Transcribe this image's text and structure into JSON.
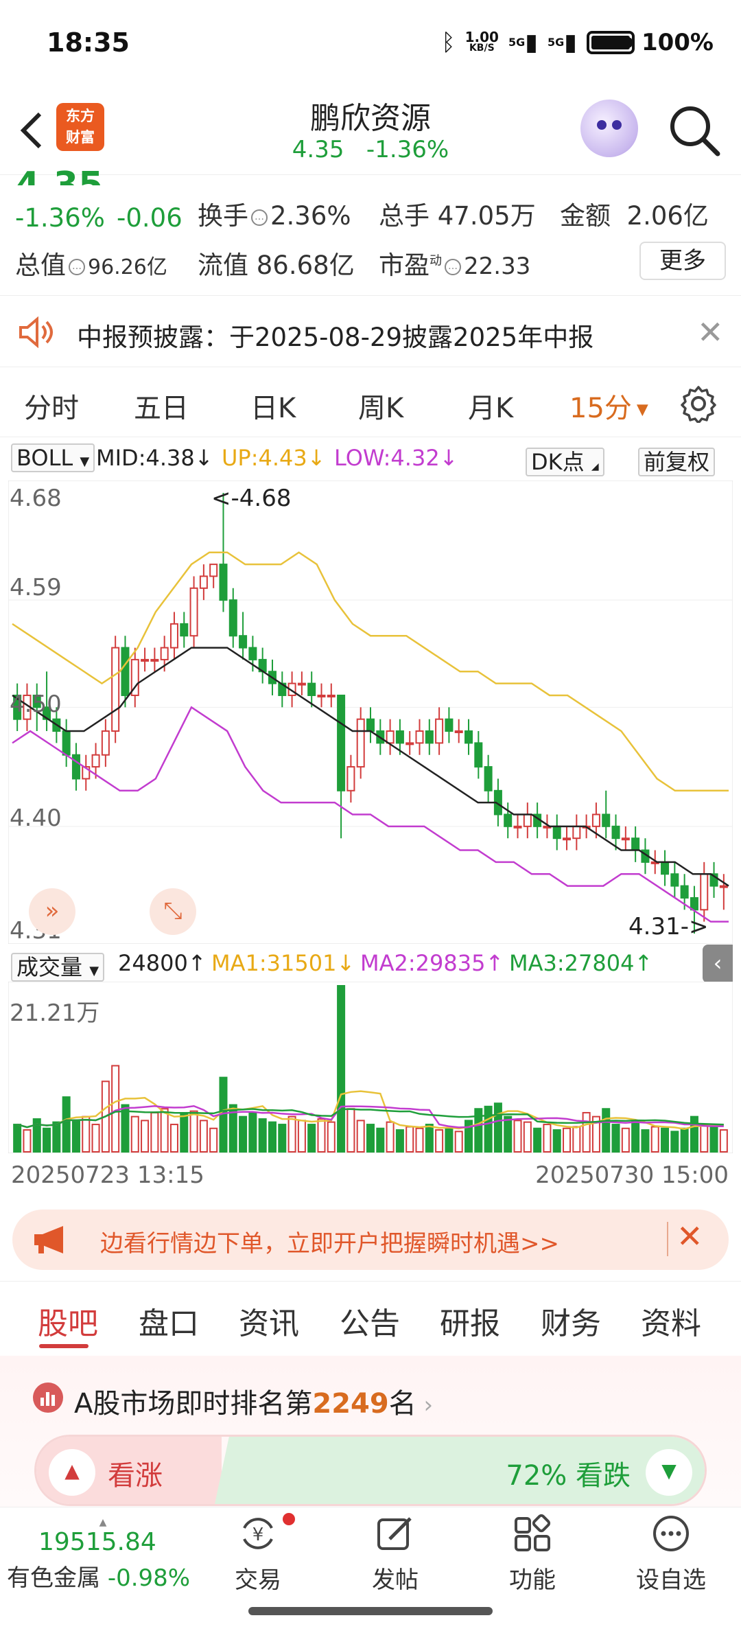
{
  "status_bar": {
    "time": "18:35",
    "speed_value": "1.00",
    "speed_unit": "KB/S",
    "net1": "5G",
    "net2": "5G",
    "battery": "100%"
  },
  "header": {
    "logo_line1": "东方",
    "logo_line2": "财富",
    "title": "鹏欣资源",
    "price": "4.35",
    "change": "-1.36%"
  },
  "quote": {
    "change_pct": "-1.36%",
    "change_amt": "-0.06",
    "turnover_label": "换手",
    "turnover": "2.36%",
    "volume_label": "总手",
    "volume": "47.05万",
    "amount_label": "金额",
    "amount": "2.06亿",
    "mcap_label": "总值",
    "mcap": "96.26亿",
    "float_label": "流值",
    "float_cap": "86.68亿",
    "pe_label": "市盈",
    "pe_sup": "动",
    "pe": "22.33",
    "more": "更多"
  },
  "notice": {
    "text": "中报预披露：于2025-08-29披露2025年中报"
  },
  "period_tabs": [
    "分时",
    "五日",
    "日K",
    "周K",
    "月K",
    "15分"
  ],
  "indicator": {
    "name": "BOLL",
    "mid": "MID:4.38↓",
    "up": "UP:4.43↓",
    "low": "LOW:4.32↓",
    "dk": "DK点",
    "adjust": "前复权"
  },
  "kchart": {
    "y_labels": [
      "4.68",
      "4.59",
      "4.50",
      "4.40",
      "4.31"
    ],
    "high_label": "<-4.68",
    "low_label": "4.31->"
  },
  "volume": {
    "name": "成交量",
    "current": "24800↑",
    "ma1": "MA1:31501↓",
    "ma2": "MA2:29835↑",
    "ma3": "MA3:27804↑",
    "max_label": "21.21万",
    "start": "20250723 13:15",
    "end": "20250730 15:00"
  },
  "ad": {
    "text": "边看行情边下单，立即开户把握瞬时机遇>>"
  },
  "tabs": [
    "股吧",
    "盘口",
    "资讯",
    "公告",
    "研报",
    "财务",
    "资料"
  ],
  "rank": {
    "prefix": "A股市场即时排名第",
    "value": "2249",
    "suffix": "名"
  },
  "vote": {
    "up": "看涨",
    "down": "72% 看跌"
  },
  "bottom_nav": {
    "index_value": "19515.84",
    "index_name": "有色金属",
    "index_change": "-0.98%",
    "items": [
      "交易",
      "发帖",
      "功能",
      "设自选"
    ]
  },
  "colors": {
    "up": "#d23c3c",
    "down": "#1e9e3a",
    "accent": "#d86b1f",
    "boll_up": "#e8c23a",
    "boll_low": "#c23ccf",
    "boll_mid": "#222222"
  },
  "chart_data": {
    "type": "candlestick",
    "ylim": [
      4.31,
      4.68
    ],
    "candles_ohlc": [
      [
        4.51,
        4.52,
        4.48,
        4.49
      ],
      [
        4.49,
        4.52,
        4.48,
        4.51
      ],
      [
        4.51,
        4.52,
        4.48,
        4.5
      ],
      [
        4.5,
        4.53,
        4.48,
        4.49
      ],
      [
        4.49,
        4.5,
        4.47,
        4.48
      ],
      [
        4.48,
        4.49,
        4.45,
        4.46
      ],
      [
        4.46,
        4.47,
        4.43,
        4.44
      ],
      [
        4.44,
        4.46,
        4.43,
        4.45
      ],
      [
        4.45,
        4.47,
        4.44,
        4.46
      ],
      [
        4.46,
        4.49,
        4.45,
        4.48
      ],
      [
        4.48,
        4.56,
        4.47,
        4.55
      ],
      [
        4.55,
        4.56,
        4.5,
        4.51
      ],
      [
        4.51,
        4.55,
        4.5,
        4.54
      ],
      [
        4.54,
        4.55,
        4.53,
        4.54
      ],
      [
        4.54,
        4.55,
        4.53,
        4.54
      ],
      [
        4.54,
        4.56,
        4.53,
        4.55
      ],
      [
        4.55,
        4.58,
        4.54,
        4.57
      ],
      [
        4.57,
        4.58,
        4.55,
        4.56
      ],
      [
        4.56,
        4.61,
        4.55,
        4.6
      ],
      [
        4.6,
        4.62,
        4.59,
        4.61
      ],
      [
        4.61,
        4.62,
        4.6,
        4.62
      ],
      [
        4.62,
        4.68,
        4.58,
        4.59
      ],
      [
        4.59,
        4.6,
        4.55,
        4.56
      ],
      [
        4.56,
        4.58,
        4.54,
        4.55
      ],
      [
        4.55,
        4.56,
        4.53,
        4.54
      ],
      [
        4.54,
        4.55,
        4.52,
        4.53
      ],
      [
        4.53,
        4.54,
        4.51,
        4.52
      ],
      [
        4.52,
        4.53,
        4.5,
        4.51
      ],
      [
        4.51,
        4.53,
        4.5,
        4.52
      ],
      [
        4.52,
        4.53,
        4.51,
        4.52
      ],
      [
        4.52,
        4.53,
        4.5,
        4.51
      ],
      [
        4.51,
        4.52,
        4.5,
        4.51
      ],
      [
        4.51,
        4.52,
        4.5,
        4.51
      ],
      [
        4.51,
        4.5,
        4.39,
        4.43
      ],
      [
        4.43,
        4.46,
        4.42,
        4.45
      ],
      [
        4.45,
        4.5,
        4.44,
        4.49
      ],
      [
        4.49,
        4.5,
        4.47,
        4.48
      ],
      [
        4.48,
        4.49,
        4.46,
        4.47
      ],
      [
        4.47,
        4.49,
        4.46,
        4.48
      ],
      [
        4.48,
        4.49,
        4.46,
        4.47
      ],
      [
        4.47,
        4.48,
        4.46,
        4.47
      ],
      [
        4.47,
        4.49,
        4.46,
        4.48
      ],
      [
        4.48,
        4.49,
        4.46,
        4.47
      ],
      [
        4.47,
        4.5,
        4.46,
        4.49
      ],
      [
        4.49,
        4.5,
        4.47,
        4.48
      ],
      [
        4.48,
        4.49,
        4.47,
        4.48
      ],
      [
        4.48,
        4.49,
        4.46,
        4.47
      ],
      [
        4.47,
        4.48,
        4.44,
        4.45
      ],
      [
        4.45,
        4.46,
        4.42,
        4.43
      ],
      [
        4.43,
        4.44,
        4.4,
        4.41
      ],
      [
        4.41,
        4.42,
        4.39,
        4.4
      ],
      [
        4.4,
        4.41,
        4.39,
        4.4
      ],
      [
        4.4,
        4.42,
        4.39,
        4.41
      ],
      [
        4.41,
        4.42,
        4.39,
        4.4
      ],
      [
        4.4,
        4.41,
        4.39,
        4.4
      ],
      [
        4.4,
        4.41,
        4.38,
        4.39
      ],
      [
        4.39,
        4.4,
        4.38,
        4.39
      ],
      [
        4.39,
        4.41,
        4.38,
        4.4
      ],
      [
        4.4,
        4.41,
        4.39,
        4.4
      ],
      [
        4.4,
        4.42,
        4.39,
        4.41
      ],
      [
        4.41,
        4.43,
        4.39,
        4.4
      ],
      [
        4.4,
        4.41,
        4.38,
        4.39
      ],
      [
        4.39,
        4.4,
        4.38,
        4.39
      ],
      [
        4.39,
        4.4,
        4.37,
        4.38
      ],
      [
        4.38,
        4.39,
        4.36,
        4.37
      ],
      [
        4.37,
        4.38,
        4.36,
        4.37
      ],
      [
        4.37,
        4.38,
        4.35,
        4.36
      ],
      [
        4.36,
        4.37,
        4.34,
        4.35
      ],
      [
        4.35,
        4.36,
        4.33,
        4.34
      ],
      [
        4.34,
        4.35,
        4.31,
        4.33
      ],
      [
        4.33,
        4.37,
        4.32,
        4.36
      ],
      [
        4.36,
        4.37,
        4.34,
        4.35
      ],
      [
        4.35,
        4.36,
        4.33,
        4.35
      ]
    ],
    "boll_up": [
      4.57,
      4.56,
      4.55,
      4.54,
      4.53,
      4.52,
      4.53,
      4.55,
      4.58,
      4.6,
      4.62,
      4.63,
      4.63,
      4.62,
      4.62,
      4.62,
      4.63,
      4.62,
      4.59,
      4.57,
      4.56,
      4.56,
      4.56,
      4.55,
      4.54,
      4.53,
      4.53,
      4.52,
      4.52,
      4.52,
      4.51,
      4.51,
      4.5,
      4.49,
      4.48,
      4.46,
      4.44,
      4.43,
      4.43,
      4.43,
      4.43
    ],
    "boll_mid": [
      4.51,
      4.5,
      4.49,
      4.48,
      4.48,
      4.49,
      4.5,
      4.52,
      4.53,
      4.54,
      4.55,
      4.55,
      4.55,
      4.54,
      4.53,
      4.52,
      4.51,
      4.5,
      4.49,
      4.48,
      4.48,
      4.47,
      4.46,
      4.45,
      4.44,
      4.43,
      4.42,
      4.42,
      4.41,
      4.41,
      4.4,
      4.4,
      4.4,
      4.39,
      4.38,
      4.38,
      4.37,
      4.37,
      4.36,
      4.36,
      4.35
    ],
    "boll_low": [
      4.47,
      4.48,
      4.47,
      4.46,
      4.45,
      4.44,
      4.43,
      4.43,
      4.44,
      4.47,
      4.5,
      4.49,
      4.48,
      4.45,
      4.43,
      4.42,
      4.42,
      4.42,
      4.42,
      4.41,
      4.41,
      4.4,
      4.4,
      4.4,
      4.39,
      4.38,
      4.38,
      4.37,
      4.37,
      4.36,
      4.36,
      4.35,
      4.35,
      4.35,
      4.36,
      4.36,
      4.35,
      4.34,
      4.33,
      4.32,
      4.32
    ],
    "volume_max": 212100,
    "volumes": [
      35000,
      28000,
      42000,
      30000,
      38000,
      70000,
      40000,
      45000,
      35000,
      90000,
      110000,
      60000,
      45000,
      40000,
      50000,
      55000,
      35000,
      48000,
      52000,
      40000,
      30000,
      95000,
      60000,
      45000,
      50000,
      42000,
      38000,
      35000,
      45000,
      40000,
      35000,
      42000,
      38000,
      212100,
      55000,
      40000,
      35000,
      30000,
      38000,
      28000,
      32000,
      30000,
      35000,
      28000,
      30000,
      26000,
      40000,
      55000,
      58000,
      62000,
      45000,
      40000,
      38000,
      30000,
      35000,
      28000,
      30000,
      32000,
      50000,
      45000,
      55000,
      35000,
      30000,
      40000,
      28000,
      32000,
      30000,
      26000,
      30000,
      45000,
      35000,
      32000,
      28000
    ]
  }
}
